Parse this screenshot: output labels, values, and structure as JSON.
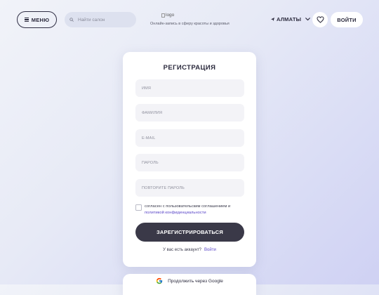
{
  "header": {
    "menu_label": "МЕНЮ",
    "search_placeholder": "Найти салон",
    "logo_alt": "logo",
    "tagline": "Онлайн-запись в сферу красоты и здоровья",
    "city": "АЛМАТЫ",
    "login_label": "ВОЙТИ"
  },
  "form": {
    "title": "РЕГИСТРАЦИЯ",
    "fields": [
      {
        "placeholder": "ИМЯ",
        "value": ""
      },
      {
        "placeholder": "ФАМИЛИЯ",
        "value": ""
      },
      {
        "placeholder": "E-MAIL",
        "value": ""
      },
      {
        "placeholder": "ПАРОЛЬ",
        "value": ""
      },
      {
        "placeholder": "ПОВТОРИТЕ ПАРОЛЬ",
        "value": ""
      }
    ],
    "agree_text": "согласен с пользовательским соглашением и",
    "agree_link": "политикой конфиденциальности",
    "submit_label": "ЗАРЕГИСТРИРОВАТЬСЯ",
    "has_account_text": "У вас есть аккаунт?",
    "signin_link": "Войти"
  },
  "google": {
    "label": "Продолжить через Google"
  },
  "colors": {
    "accent": "#5a46c8",
    "primary_button": "#3a3948",
    "field_bg": "#f3f3f7"
  },
  "icons": {
    "menu": "hamburger-icon",
    "search": "search-icon",
    "city": "location-arrow-icon",
    "chevron": "chevron-down-icon",
    "favorites": "heart-icon",
    "google": "google-icon"
  }
}
